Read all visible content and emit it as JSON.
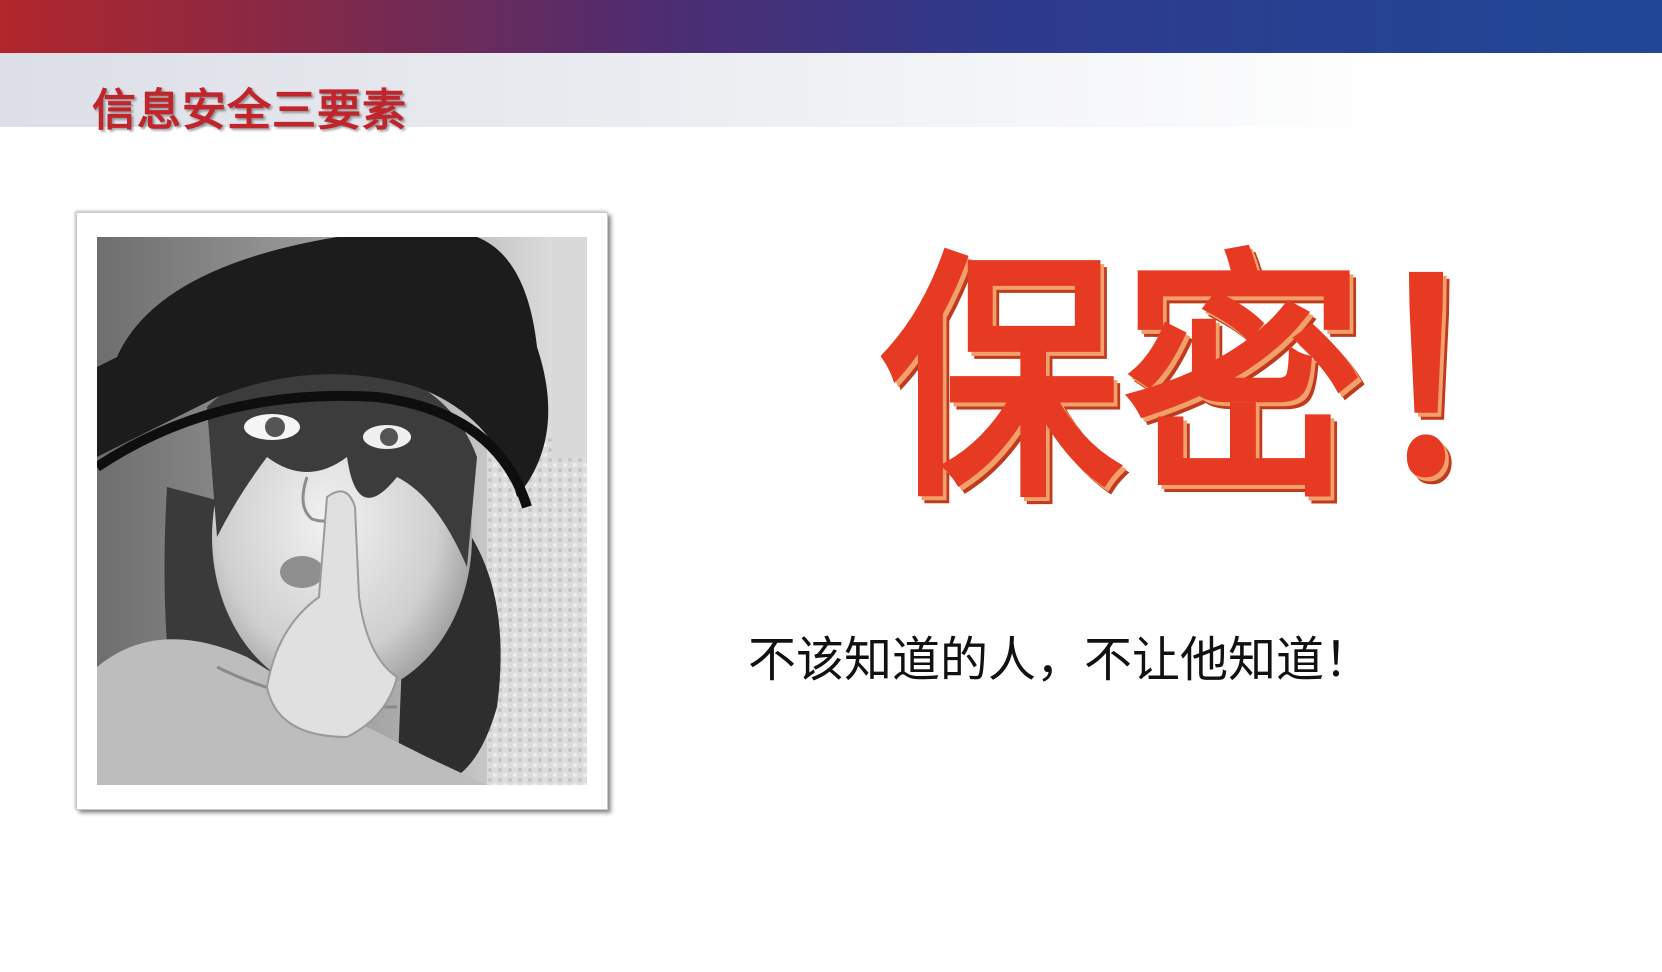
{
  "slide": {
    "title": "信息安全三要素",
    "headline": "保密！",
    "slogan": "不该知道的人，不让他知道！"
  },
  "photo": {
    "subject": "girl-in-hat-shushing-photo"
  },
  "colors": {
    "title_red": "#c0252b",
    "headline_red": "#e63b22",
    "bar_left": "#b3262b",
    "bar_right": "#1f4796"
  }
}
